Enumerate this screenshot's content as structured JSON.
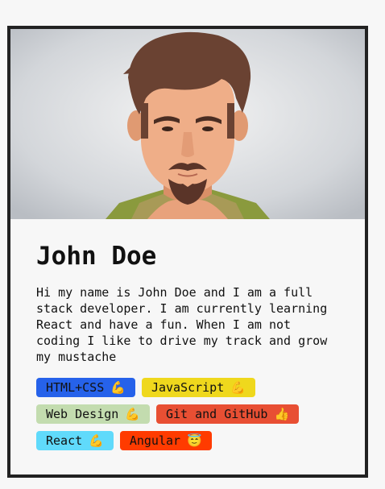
{
  "profile": {
    "name": "John Doe",
    "intro": "Hi my name is John Doe and I am a full stack developer. I am currently learning React and have a fun. When I am not coding I like to drive my track and grow my mustache"
  },
  "skills": [
    {
      "label": "HTML+CSS",
      "emoji": "💪",
      "color": "#2662ea"
    },
    {
      "label": "JavaScript",
      "emoji": "💪",
      "color": "#efd81d"
    },
    {
      "label": "Web Design",
      "emoji": "💪",
      "color": "#c3dcaf"
    },
    {
      "label": "Git and GitHub",
      "emoji": "👍",
      "color": "#e84f33"
    },
    {
      "label": "React",
      "emoji": "💪",
      "color": "#60dafb"
    },
    {
      "label": "Angular",
      "emoji": "😇",
      "color": "#ff3b00"
    }
  ]
}
